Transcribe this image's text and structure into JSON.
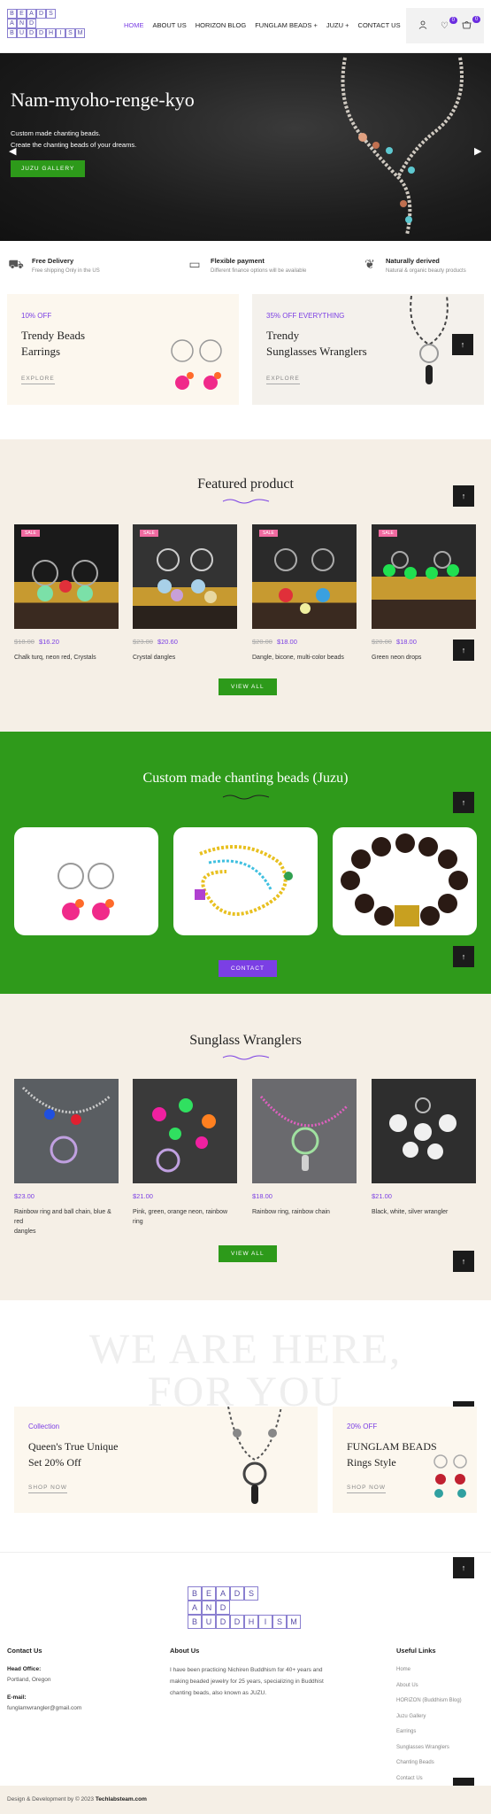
{
  "header": {
    "logo_letters": [
      "B",
      "E",
      "A",
      "D",
      "S",
      "A",
      "N",
      "D",
      "B",
      "U",
      "D",
      "D",
      "H",
      "I",
      "S",
      "M"
    ],
    "nav": [
      "HOME",
      "ABOUT US",
      "HORIZON BLOG",
      "FUNGLAM BEADS",
      "JUZU",
      "CONTACT US"
    ],
    "wishlist_count": "0",
    "cart_count": "0"
  },
  "hero": {
    "title": "Nam-myoho-renge-kyo",
    "subtitle_line1": "Custom made chanting beads.",
    "subtitle_line2": "Create the chanting beads of your dreams.",
    "button": "JUZU GALLERY"
  },
  "features": [
    {
      "icon": "truck-icon",
      "title": "Free Delivery",
      "sub": "Free shipping Only in the US"
    },
    {
      "icon": "payment-icon",
      "title": "Flexible payment",
      "sub": "Different finance options will be available"
    },
    {
      "icon": "leaf-icon",
      "title": "Naturally derived",
      "sub": "Natural & organic beauty products"
    }
  ],
  "promos": [
    {
      "tag": "10% OFF",
      "title_line1": "Trendy Beads",
      "title_line2": "Earrings",
      "link": "EXPLORE"
    },
    {
      "tag": "35% OFF EVERYTHING",
      "title_line1": "Trendy",
      "title_line2": "Sunglasses Wranglers",
      "link": "EXPLORE"
    }
  ],
  "featured": {
    "title": "Featured product",
    "products": [
      {
        "badge": "SALE",
        "old": "$18.00",
        "price": "$16.20",
        "name": "Chalk turq, neon red, Crystals"
      },
      {
        "badge": "SALE",
        "old": "$23.00",
        "price": "$20.60",
        "name": "Crystal dangles"
      },
      {
        "badge": "SALE",
        "old": "$20.00",
        "price": "$18.00",
        "name": "Dangle, bicone, multi-color beads"
      },
      {
        "badge": "SALE",
        "old": "$20.00",
        "price": "$18.00",
        "name": "Green neon drops"
      }
    ],
    "button": "VIEW ALL"
  },
  "juzu": {
    "title": "Custom made chanting beads (Juzu)",
    "button": "CONTACT"
  },
  "wranglers": {
    "title": "Sunglass Wranglers",
    "products": [
      {
        "price": "$23.00",
        "name_line1": "Rainbow ring and ball chain, blue & red",
        "name_line2": "dangles"
      },
      {
        "price": "$21.00",
        "name_line1": "Pink, green, orange neon, rainbow ring",
        "name_line2": ""
      },
      {
        "price": "$18.00",
        "name_line1": "Rainbow ring, rainbow chain",
        "name_line2": ""
      },
      {
        "price": "$21.00",
        "name_line1": "Black, white, silver wrangler",
        "name_line2": ""
      }
    ],
    "button": "VIEW ALL"
  },
  "here": {
    "big_line1": "WE ARE HERE,",
    "big_line2": "FOR YOU",
    "promo1": {
      "tag": "Collection",
      "title_line1": "Queen's True Unique",
      "title_line2": "Set 20% Off",
      "link": "SHOP NOW"
    },
    "promo2": {
      "tag": "20% OFF",
      "title_line1": "FUNGLAM BEADS",
      "title_line2": "Rings Style",
      "link": "SHOP NOW"
    }
  },
  "footer": {
    "contact_heading": "Contact Us",
    "head_office_label": "Head Office:",
    "head_office": "Portland, Oregon",
    "email_label": "E-mail:",
    "email": "funglamwrangler@gmail.com",
    "about_heading": "About Us",
    "about_line1": "I have been practicing Nichiren Buddhism for 40+ years and",
    "about_line2": "making beaded jewelry for 25 years, specializing in Buddhist",
    "about_line3": "chanting beads, also known as JUZU.",
    "links_heading": "Useful Links",
    "links": [
      "Home",
      "About Us",
      "HORIZON (Buddhism Blog)",
      "Juzu Gallery",
      "Earrings",
      "Sunglasses Wranglers",
      "Chanting Beads",
      "Contact Us"
    ],
    "copyright_prefix": "Design & Development by © 2023",
    "copyright_brand": "Techlabsteam.com"
  },
  "colors": {
    "accent_purple": "#7b3fe4",
    "green": "#2d9a1a",
    "cream": "#f5efe6"
  }
}
